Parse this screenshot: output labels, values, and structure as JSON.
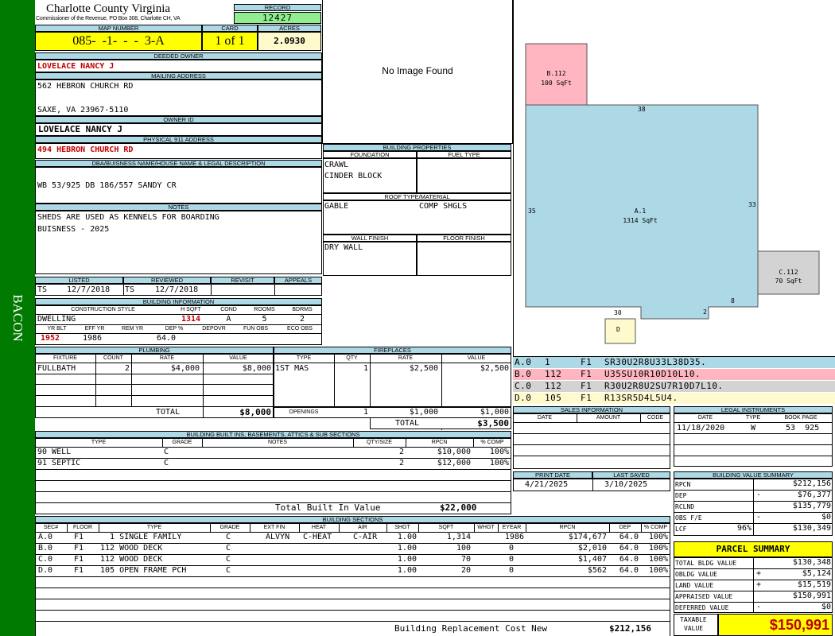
{
  "colors": {
    "sidebar": "#007a00",
    "header_bg": "#add8e6",
    "yellow": "#ffff00",
    "record_green": "#90ee90",
    "sketch_blue": "#add8e6",
    "sketch_pink": "#ffb6c1",
    "sketch_gray": "#d3d3d3",
    "sketch_cream": "#fffacd",
    "red": "#c00000"
  },
  "sidebar": {
    "label": "BACON"
  },
  "county": {
    "title": "Charlotte County Virginia",
    "subtitle": "Commissioner of the Revenue, PO Box 308, Charlotte CH, VA"
  },
  "record": {
    "label": "RECORD",
    "value": "12427"
  },
  "map": {
    "label": "MAP NUMBER",
    "value": "085-  -1-  -  -  3-A",
    "card_label": "CARD",
    "card_value": "1 of 1",
    "acres_label": "ACRES",
    "acres_value": "2.0930"
  },
  "deeded": {
    "label": "DEEDED OWNER",
    "value": "LOVELACE NANCY J"
  },
  "mailing": {
    "label": "MAILING ADDRESS",
    "line1": "562 HEBRON CHURCH RD",
    "line2": "SAXE, VA 23967-5110"
  },
  "owner_id": {
    "label": "OWNER ID",
    "value": "LOVELACE NANCY J"
  },
  "physical": {
    "label": "PHYSICAL 911 ADDRESS",
    "value": "494 HEBRON CHURCH RD"
  },
  "dba": {
    "label": "DBA/BUISNESS NAME/HOUSE NAME & LEGAL DESCRIPTION",
    "value": "WB 53/925 DB 186/557 SANDY CR"
  },
  "notes": {
    "label": "NOTES",
    "line1": "SHEDS ARE USED AS KENNELS FOR BOARDING",
    "line2": "BUISNESS - 2025"
  },
  "image": {
    "text": "No Image Found"
  },
  "props": {
    "title": "BUILDING PROPERTIES",
    "foundation_label": "FOUNDATION",
    "fuel_label": "FUEL TYPE",
    "foundation1": "CRAWL",
    "foundation2": "CINDER BLOCK",
    "roof_label": "ROOF TYPE/MATERIAL",
    "roof1": "GABLE",
    "roof2": "COMP SHGLS",
    "wall_label": "WALL FINISH",
    "floor_label": "FLOOR FINISH",
    "wall": "DRY WALL"
  },
  "listed": {
    "listed_label": "LISTED",
    "reviewed_label": "REVIEWED",
    "revisit_label": "REVISIT",
    "appeals_label": "APPEALS",
    "l_by": "TS",
    "l_date": "12/7/2018",
    "r_by": "TS",
    "r_date": "12/7/2018"
  },
  "bldg_info": {
    "title": "BUILDING INFORMATION",
    "cs_label": "CONSTRUCTION STYLE",
    "hsqft_label": "H SQFT",
    "cond_label": "COND",
    "rooms_label": "ROOMS",
    "bdrms_label": "BDRMS",
    "cs": "DWELLING",
    "hsqft": "1314",
    "cond": "A",
    "rooms": "5",
    "bdrms": "2",
    "yb_label": "YR BLT",
    "ey_label": "EFF YR",
    "rm_label": "REM YR",
    "dep_label": "DEP %",
    "depovr_label": "DEPOVR",
    "funobs_label": "FUN OBS",
    "ecoobs_label": "ECO OBS",
    "yb": "1952",
    "ey": "1986",
    "dep": "64.0"
  },
  "plumbing": {
    "title": "PLUMBING",
    "h_fixture": "FIXTURE",
    "h_count": "COUNT",
    "h_rate": "RATE",
    "h_value": "VALUE",
    "fixture": "FULLBATH",
    "count": "2",
    "rate": "$4,000",
    "value": "$8,000",
    "total_label": "TOTAL",
    "total": "$8,000"
  },
  "fireplaces": {
    "title": "FIREPLACES",
    "h_type": "TYPE",
    "h_qty": "QTY",
    "h_rate": "RATE",
    "h_value": "VALUE",
    "type": "1ST MAS",
    "qty": "1",
    "rate": "$2,500",
    "value": "$2,500",
    "openings_label": "OPENINGS",
    "o_qty": "1",
    "o_rate": "$1,000",
    "o_value": "$1,000",
    "total_label": "TOTAL",
    "total": "$3,500"
  },
  "builtins": {
    "title": "BUILDING BUILT INS, BASEMENTS, ATTICS & SUB SECTIONS",
    "h_type": "TYPE",
    "h_grade": "GRADE",
    "h_notes": "NOTES",
    "h_qty": "QTY/SIZE",
    "h_rpcn": "RPCN",
    "h_comp": "% COMP",
    "rows": [
      {
        "type": "90 WELL",
        "grade": "C",
        "qty": "2",
        "rpcn": "$10,000",
        "comp": "100%"
      },
      {
        "type": "91 SEPTIC",
        "grade": "C",
        "qty": "2",
        "rpcn": "$12,000",
        "comp": "100%"
      }
    ],
    "total_label": "Total Built In Value",
    "total": "$22,000"
  },
  "sections": {
    "title": "BUILDING SECTIONS",
    "h": [
      "SEC#",
      "FLOOR",
      "TYPE",
      "GRADE",
      "EXT FIN",
      "HEAT",
      "AIR",
      "SHGT",
      "SQFT",
      "WHGT",
      "EYEAR",
      "RPCN",
      "DEP",
      "% COMP"
    ],
    "rows": [
      {
        "sec": "A.0",
        "floor": "F1",
        "type": "  1 SINGLE FAMILY",
        "grade": "C",
        "ext": "ALVYN",
        "heat": "C-HEAT",
        "air": "C-AIR",
        "shgt": "1.00",
        "sqft": "1,314",
        "whgt": "",
        "eyear": "1986",
        "rpcn": "$174,677",
        "dep": "64.0",
        "comp": "100%"
      },
      {
        "sec": "B.0",
        "floor": "F1",
        "type": "112 WOOD DECK",
        "grade": "C",
        "ext": "",
        "heat": "",
        "air": "",
        "shgt": "1.00",
        "sqft": "100",
        "whgt": "0",
        "eyear": "",
        "rpcn": "$2,010",
        "dep": "64.0",
        "comp": "100%"
      },
      {
        "sec": "C.0",
        "floor": "F1",
        "type": "112 WOOD DECK",
        "grade": "C",
        "ext": "",
        "heat": "",
        "air": "",
        "shgt": "1.00",
        "sqft": "70",
        "whgt": "0",
        "eyear": "",
        "rpcn": "$1,407",
        "dep": "64.0",
        "comp": "100%"
      },
      {
        "sec": "D.0",
        "floor": "F1",
        "type": "105 OPEN FRAME PCH",
        "grade": "C",
        "ext": "",
        "heat": "",
        "air": "",
        "shgt": "1.00",
        "sqft": "20",
        "whgt": "0",
        "eyear": "",
        "rpcn": "$562",
        "dep": "64.0",
        "comp": "100%"
      }
    ],
    "total_label": "Building Replacement Cost New",
    "total": "$212,156"
  },
  "sketch": {
    "b_label": "B.112",
    "b_area": "100 SqFt",
    "a_label": "A.1",
    "a_area": "1314 SqFt",
    "c_label": "C.112",
    "c_area": "70 SqFt",
    "d_label": "D",
    "dim_top": "38",
    "dim_left": "35",
    "dim_right": "33",
    "dim_bottom": "30",
    "dim_2": "2",
    "dim_8": "8"
  },
  "vectors": [
    {
      "sec": "A.0",
      "code": "1",
      "floor": "F1",
      "vec": "SR30U2R8U33L38D35."
    },
    {
      "sec": "B.0",
      "code": "112",
      "floor": "F1",
      "vec": "U35SU10R10D10L10."
    },
    {
      "sec": "C.0",
      "code": "112",
      "floor": "F1",
      "vec": "R30U2R8U2SU7R10D7L10."
    },
    {
      "sec": "D.0",
      "code": "105",
      "floor": "F1",
      "vec": "R13SR5D4L5U4."
    }
  ],
  "sales": {
    "title": "SALES INFORMATION",
    "h_date": "DATE",
    "h_amount": "AMOUNT",
    "h_code": "CODE"
  },
  "legal": {
    "title": "LEGAL INSTRUMENTS",
    "h_date": "DATE",
    "h_type": "TYPE",
    "h_book": "BOOK PAGE",
    "date": "11/18/2020",
    "type": "W",
    "book": "53  925"
  },
  "print": {
    "print_label": "PRINT DATE",
    "saved_label": "LAST SAVED",
    "print_date": "4/21/2025",
    "saved_date": "3/10/2025"
  },
  "bvs": {
    "title": "BUILDING VALUE SUMMARY",
    "rpcn_label": "RPCN",
    "rpcn": "$212,156",
    "dep_label": "DEP",
    "dep_sign": "-",
    "dep": "$76,377",
    "rclnd_label": "RCLND",
    "rclnd": "$135,779",
    "obs_label": "OBS F/E",
    "obs_sign": "-",
    "obs": "$0",
    "lcf_label": "LCF",
    "lcf_pct": "96%",
    "lcf": "$130,349"
  },
  "parcel": {
    "title": "PARCEL SUMMARY",
    "tbv_label": "TOTAL BLDG VALUE",
    "tbv": "$130,348",
    "obldg_label": "OBLDG VALUE",
    "obldg_sign": "+",
    "obldg": "$5,124",
    "land_label": "LAND VALUE",
    "land_sign": "+",
    "land": "$15,519",
    "appr_label": "APPRAISED VALUE",
    "appr": "$150,991",
    "def_label": "DEFERRED VALUE",
    "def_sign": "-",
    "def": "$0",
    "tax_label1": "TAXABLE",
    "tax_label2": "VALUE",
    "tax": "$150,991"
  }
}
